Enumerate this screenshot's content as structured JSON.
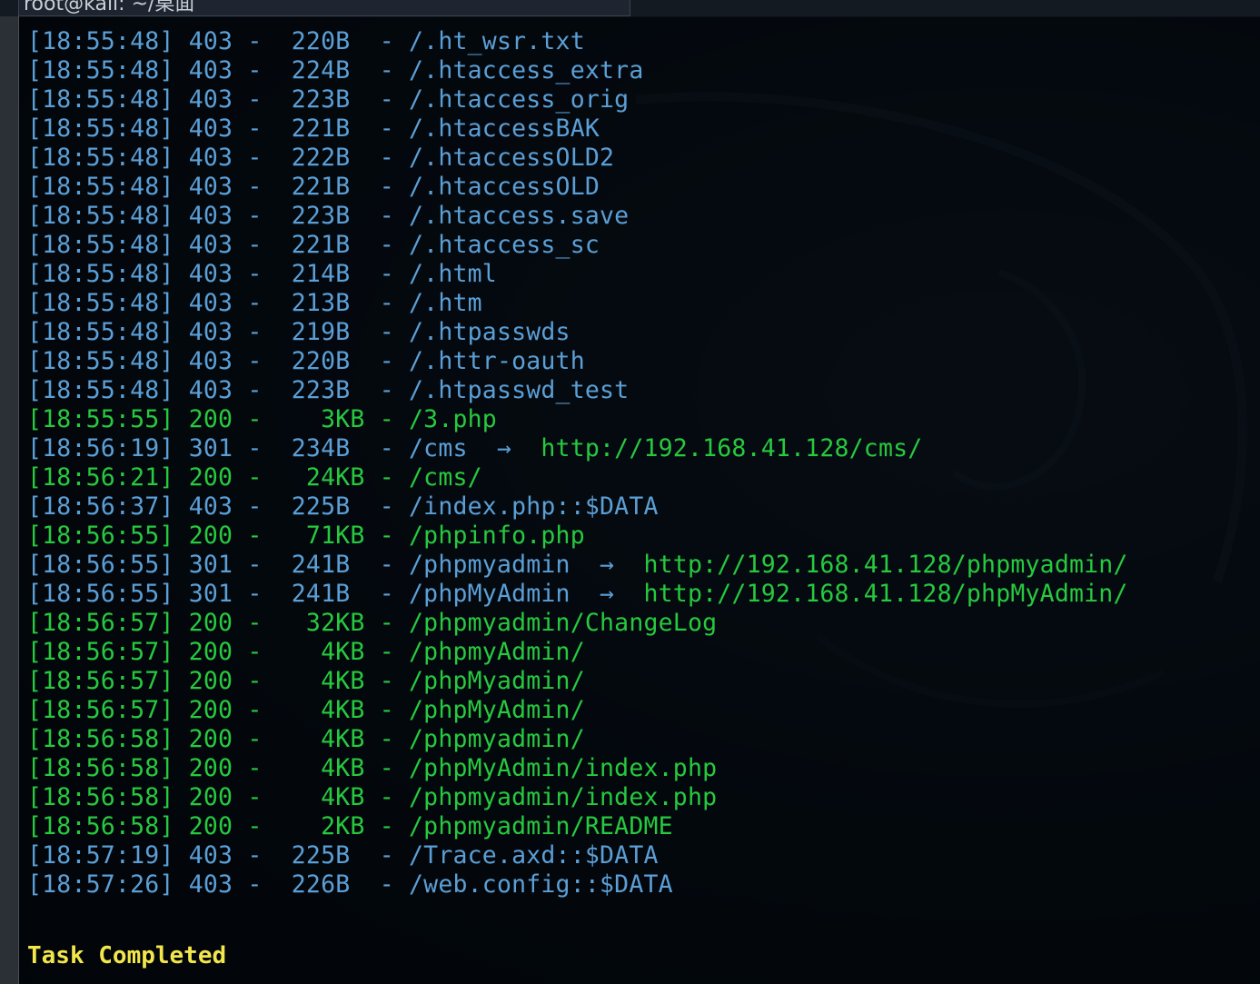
{
  "window": {
    "tab_title": "root@kali: ~/桌面"
  },
  "colors": {
    "forbidden": "#5b9fd6",
    "success": "#27c93f",
    "task": "#f2e64b"
  },
  "lines": [
    {
      "text": "[18:55:48] 403 -  220B  - /.ht_wsr.txt",
      "color": "blue"
    },
    {
      "text": "[18:55:48] 403 -  224B  - /.htaccess_extra",
      "color": "blue"
    },
    {
      "text": "[18:55:48] 403 -  223B  - /.htaccess_orig",
      "color": "blue"
    },
    {
      "text": "[18:55:48] 403 -  221B  - /.htaccessBAK",
      "color": "blue"
    },
    {
      "text": "[18:55:48] 403 -  222B  - /.htaccessOLD2",
      "color": "blue"
    },
    {
      "text": "[18:55:48] 403 -  221B  - /.htaccessOLD",
      "color": "blue"
    },
    {
      "text": "[18:55:48] 403 -  223B  - /.htaccess.save",
      "color": "blue"
    },
    {
      "text": "[18:55:48] 403 -  221B  - /.htaccess_sc",
      "color": "blue"
    },
    {
      "text": "[18:55:48] 403 -  214B  - /.html",
      "color": "blue"
    },
    {
      "text": "[18:55:48] 403 -  213B  - /.htm",
      "color": "blue"
    },
    {
      "text": "[18:55:48] 403 -  219B  - /.htpasswds",
      "color": "blue"
    },
    {
      "text": "[18:55:48] 403 -  220B  - /.httr-oauth",
      "color": "blue"
    },
    {
      "text": "[18:55:48] 403 -  223B  - /.htpasswd_test",
      "color": "blue"
    },
    {
      "text": "[18:55:55] 200 -    3KB - /3.php",
      "color": "green"
    },
    {
      "text": "[18:56:19] 301 -  234B  - /cms  ->  http://192.168.41.128/cms/",
      "color": "blue",
      "link_color": "green"
    },
    {
      "text": "[18:56:21] 200 -   24KB - /cms/",
      "color": "green"
    },
    {
      "text": "[18:56:37] 403 -  225B  - /index.php::$DATA",
      "color": "blue"
    },
    {
      "text": "[18:56:55] 200 -   71KB - /phpinfo.php",
      "color": "green"
    },
    {
      "text": "[18:56:55] 301 -  241B  - /phpmyadmin  ->  http://192.168.41.128/phpmyadmin/",
      "color": "blue",
      "link_color": "green"
    },
    {
      "text": "[18:56:55] 301 -  241B  - /phpMyAdmin  ->  http://192.168.41.128/phpMyAdmin/",
      "color": "blue",
      "link_color": "green"
    },
    {
      "text": "[18:56:57] 200 -   32KB - /phpmyadmin/ChangeLog",
      "color": "green"
    },
    {
      "text": "[18:56:57] 200 -    4KB - /phpmyAdmin/",
      "color": "green"
    },
    {
      "text": "[18:56:57] 200 -    4KB - /phpMyadmin/",
      "color": "green"
    },
    {
      "text": "[18:56:57] 200 -    4KB - /phpMyAdmin/",
      "color": "green"
    },
    {
      "text": "[18:56:58] 200 -    4KB - /phpmyadmin/",
      "color": "green"
    },
    {
      "text": "[18:56:58] 200 -    4KB - /phpMyAdmin/index.php",
      "color": "green"
    },
    {
      "text": "[18:56:58] 200 -    4KB - /phpmyadmin/index.php",
      "color": "green"
    },
    {
      "text": "[18:56:58] 200 -    2KB - /phpmyadmin/README",
      "color": "green"
    },
    {
      "text": "[18:57:19] 403 -  225B  - /Trace.axd::$DATA",
      "color": "blue"
    },
    {
      "text": "[18:57:26] 403 -  226B  - /web.config::$DATA",
      "color": "blue"
    }
  ],
  "footer": {
    "task_status": "Task Completed"
  }
}
